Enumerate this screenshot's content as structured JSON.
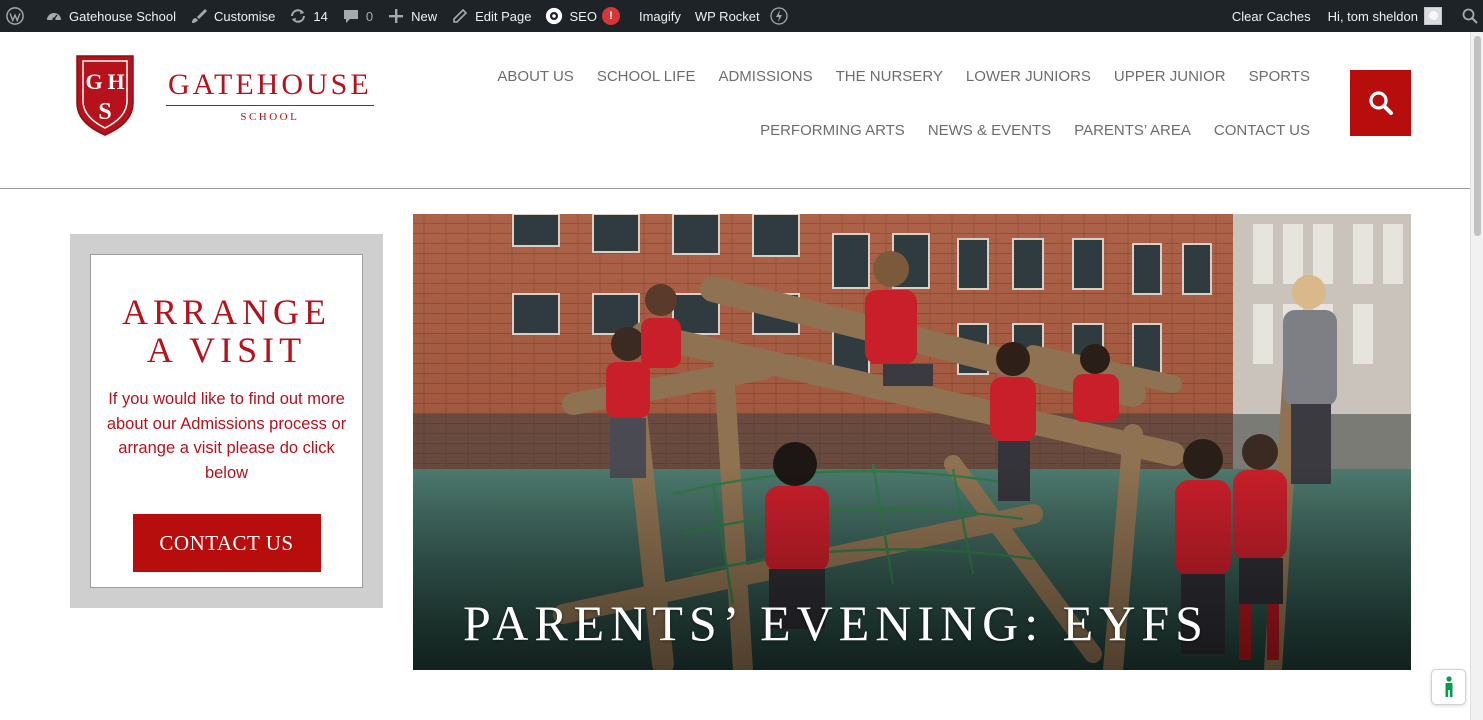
{
  "adminbar": {
    "site_name": "Gatehouse School",
    "customise": "Customise",
    "updates_count": "14",
    "comments_count": "0",
    "new_label": "New",
    "edit_page": "Edit Page",
    "seo_label": "SEO",
    "seo_badge": "!",
    "imagify": "Imagify",
    "wp_rocket": "WP Rocket",
    "clear_caches": "Clear Caches",
    "greeting": "Hi, tom sheldon"
  },
  "logo": {
    "crest_letters": "GHS",
    "name": "GATEHOUSE",
    "sub": "SCHOOL"
  },
  "nav": {
    "row1": [
      "ABOUT US",
      "SCHOOL LIFE",
      "ADMISSIONS",
      "THE NURSERY",
      "LOWER JUNIORS",
      "UPPER JUNIOR",
      "SPORTS"
    ],
    "row2": [
      "PERFORMING ARTS",
      "NEWS & EVENTS",
      "PARENTS’ AREA",
      "CONTACT US"
    ]
  },
  "visit": {
    "title": "ARRANGE A VISIT",
    "text": "If you would like to find out more about our Admissions process or arrange a visit please do click below",
    "button": "CONTACT US"
  },
  "hero": {
    "caption": "PARENTS’ EVENING: EYFS"
  },
  "colors": {
    "brand_red": "#b5121b",
    "button_red": "#b80d0d",
    "adminbar_bg": "#1d2327"
  },
  "icons": {
    "wp": "wordpress-icon",
    "site": "dashboard-icon",
    "customise": "paintbrush-icon",
    "updates": "refresh-icon",
    "comments": "speech-bubble-icon",
    "new": "plus-icon",
    "edit": "pencil-icon",
    "seo": "seo-gear-icon",
    "rocket": "lightning-icon",
    "search": "search-icon",
    "accessibility": "accessibility-icon"
  }
}
